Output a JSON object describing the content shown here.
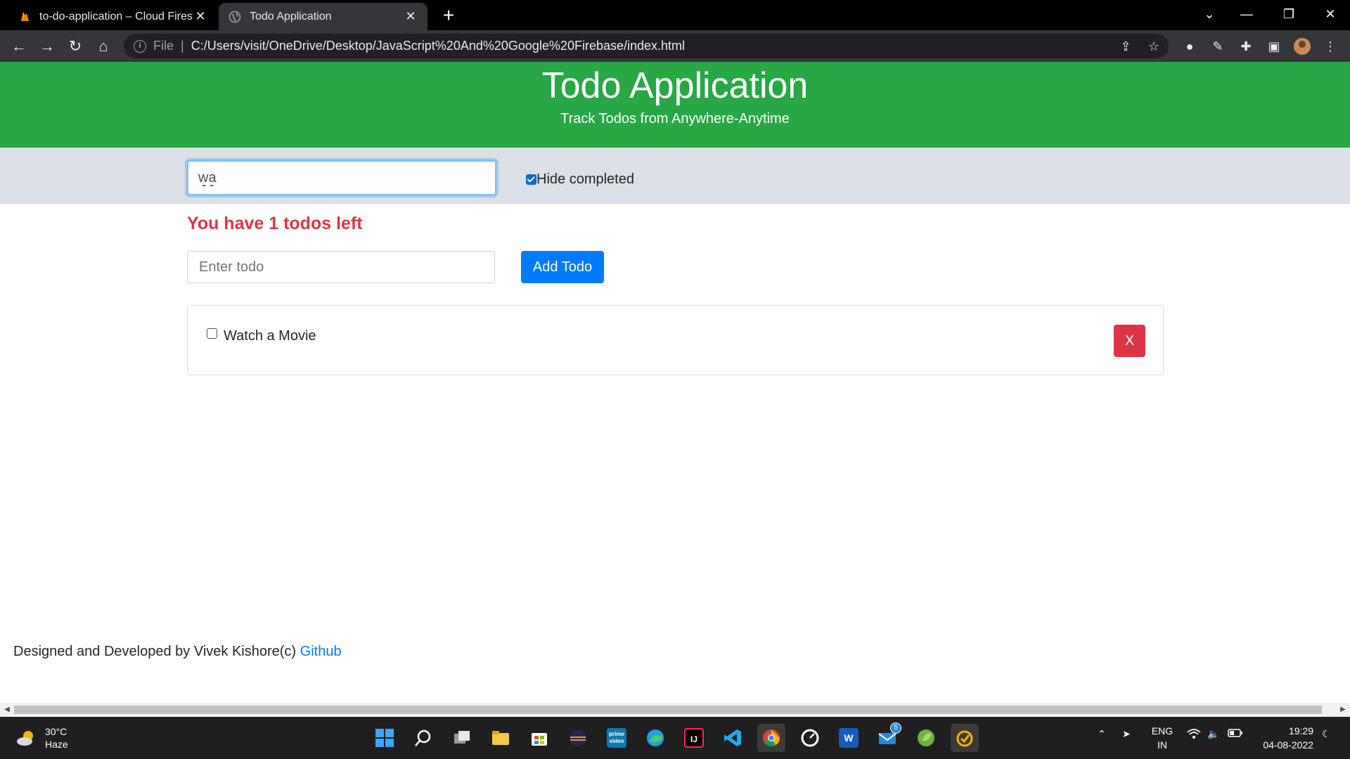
{
  "browser": {
    "tabs": [
      {
        "title": "to-do-application – Cloud Firestore",
        "active": false,
        "favicon": "firebase-flame-icon"
      },
      {
        "title": "Todo Application",
        "active": true,
        "favicon": "globe-icon"
      }
    ],
    "address": {
      "scheme": "File",
      "url": "C:/Users/visit/OneDrive/Desktop/JavaScript%20And%20Google%20Firebase/index.html"
    }
  },
  "header": {
    "title": "Todo Application",
    "subtitle": "Track Todos from Anywhere-Anytime"
  },
  "filter": {
    "search_value": "wa",
    "hide_completed_label": "Hide completed",
    "hide_completed_checked": true
  },
  "status": {
    "todos_left_text": "You have 1 todos left"
  },
  "new_todo": {
    "placeholder": "Enter todo",
    "add_label": "Add Todo"
  },
  "todos": [
    {
      "text": "Watch a Movie",
      "done": false,
      "delete_label": "X"
    }
  ],
  "footer": {
    "text": "Designed and Developed by Vivek Kishore(c) ",
    "link_label": "Github"
  },
  "taskbar": {
    "weather": {
      "temp": "30°C",
      "condition": "Haze"
    },
    "language": {
      "line1": "ENG",
      "line2": "IN"
    },
    "time": "19:29",
    "date": "04-08-2022",
    "mail_badge": "5"
  },
  "colors": {
    "header_bg": "#28a745",
    "filter_bg": "#dae0e5",
    "danger": "#dc3545",
    "primary": "#007bff"
  }
}
